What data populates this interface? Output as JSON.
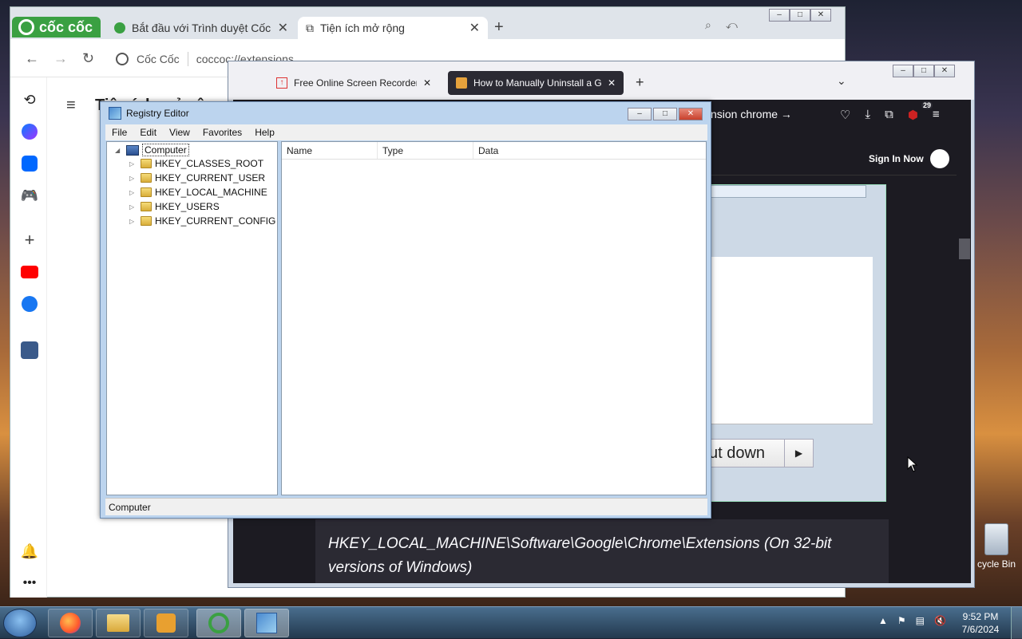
{
  "coccoc": {
    "brand": "cốc cốc",
    "tabs": [
      {
        "title": "Bắt đầu với Trình duyệt Cốc Cốc"
      },
      {
        "title": "Tiện ích mở rộng"
      }
    ],
    "omnibox": {
      "site": "Cốc Cốc",
      "url": "coccoc://extensions"
    },
    "page_title": "Tiện ích mở rộng",
    "sidebar_icons": [
      "history-icon",
      "messenger-icon",
      "zalo-icon",
      "game-icon",
      "add-icon",
      "youtube-icon",
      "facebook-icon",
      "game-app-icon",
      "bell-icon",
      "more-icon"
    ]
  },
  "firefox": {
    "tabs": [
      {
        "title": "Free Online Screen Recorder &"
      },
      {
        "title": "How to Manually Uninstall a Gl"
      }
    ],
    "url_tail": "nsion chrome",
    "badge_count": "29",
    "sign_in": "Sign In Now",
    "shutdown_label": "ut down",
    "quote": "HKEY_LOCAL_MACHINE\\Software\\Google\\Chrome\\Extensions (On 32-bit versions of Windows)"
  },
  "regedit": {
    "title": "Registry Editor",
    "menu": [
      "File",
      "Edit",
      "View",
      "Favorites",
      "Help"
    ],
    "root": "Computer",
    "keys": [
      "HKEY_CLASSES_ROOT",
      "HKEY_CURRENT_USER",
      "HKEY_LOCAL_MACHINE",
      "HKEY_USERS",
      "HKEY_CURRENT_CONFIG"
    ],
    "columns": [
      "Name",
      "Type",
      "Data"
    ],
    "status": "Computer"
  },
  "desktop": {
    "recycle_bin": "cycle Bin"
  },
  "taskbar": {
    "time": "9:52 PM",
    "date": "7/6/2024"
  },
  "colors": {
    "coccoc_green": "#3aa042",
    "firefox_dark": "#1c1b22",
    "win7_frame": "#bcd4ee"
  }
}
